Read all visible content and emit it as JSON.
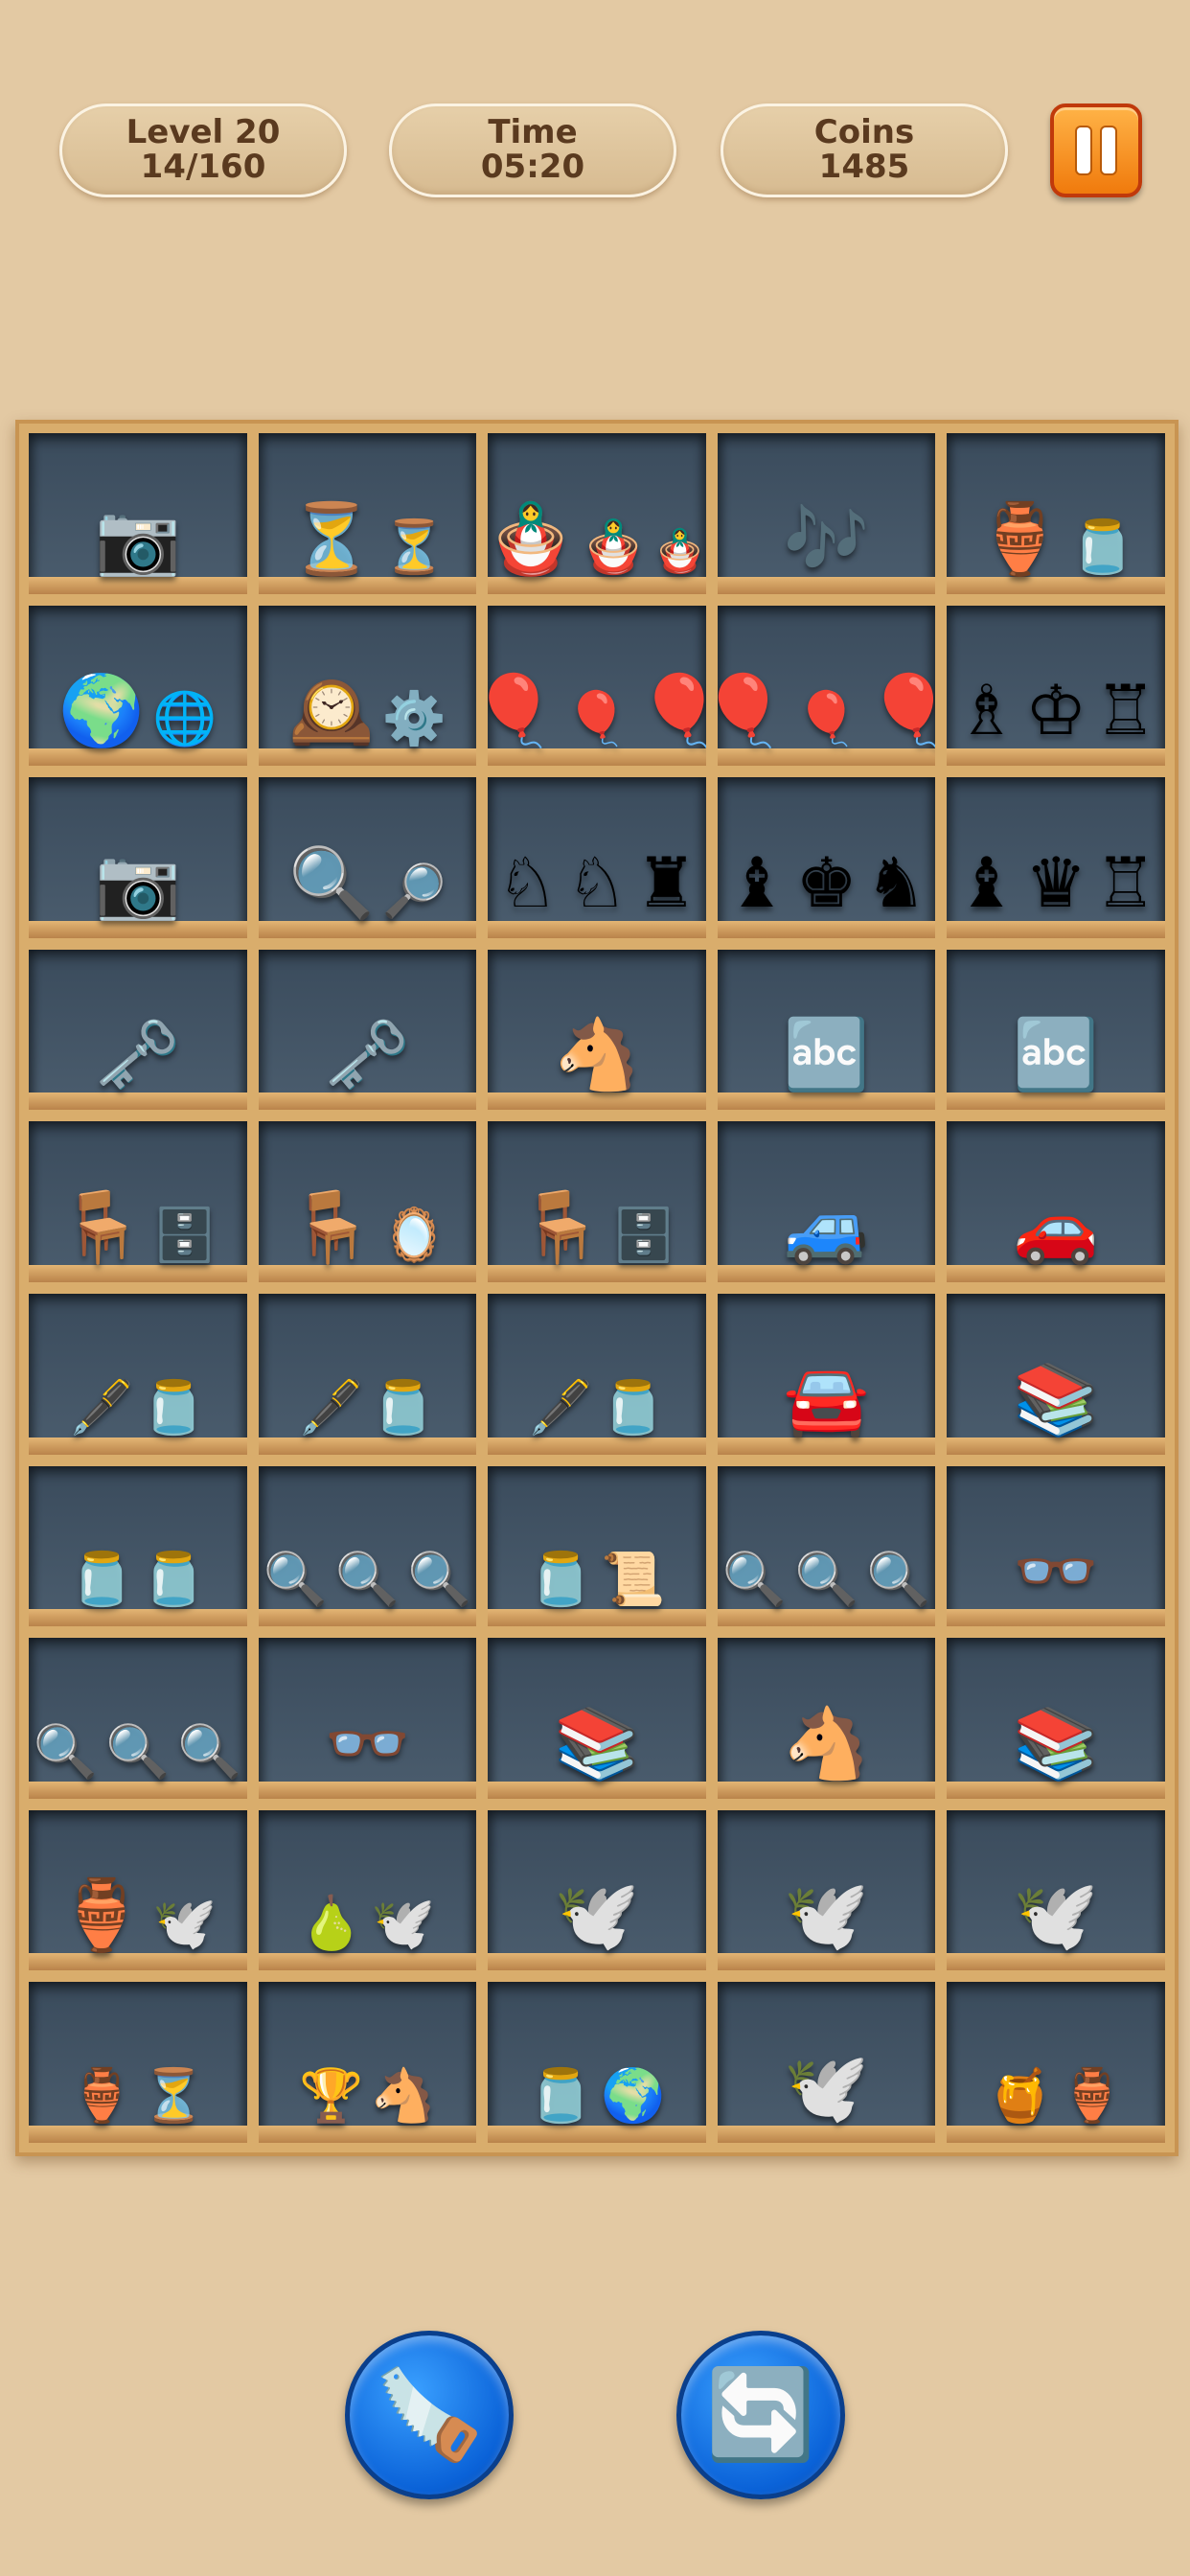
{
  "hud": {
    "level_label": "Level 20",
    "level_progress": "14/160",
    "time_label": "Time",
    "time_value": "05:20",
    "coins_label": "Coins",
    "coins_value": "1485"
  },
  "shelf": {
    "rows": [
      [
        {
          "items": [
            {
              "icon": "📷",
              "name": "vintage-camera-icon"
            }
          ]
        },
        {
          "items": [
            {
              "icon": "⏳",
              "name": "hourglass-icon"
            },
            {
              "icon": "⏳",
              "name": "hourglass-small-icon",
              "size": "sm"
            }
          ]
        },
        {
          "items": [
            {
              "icon": "🪆",
              "name": "nesting-doll-icon"
            },
            {
              "icon": "🪆",
              "name": "nesting-doll-medium-icon",
              "size": "sm"
            },
            {
              "icon": "🪆",
              "name": "nesting-doll-small-icon",
              "size": "xs"
            }
          ]
        },
        {
          "items": [
            {
              "icon": "🎶",
              "name": "music-box-icon"
            }
          ]
        },
        {
          "items": [
            {
              "icon": "🏺",
              "name": "painted-jar-icon"
            },
            {
              "icon": "🫙",
              "name": "porcelain-jar-icon",
              "size": "sm"
            }
          ]
        }
      ],
      [
        {
          "items": [
            {
              "icon": "🌍",
              "name": "globe-icon"
            },
            {
              "icon": "🌐",
              "name": "globe-small-icon",
              "size": "sm"
            }
          ]
        },
        {
          "items": [
            {
              "icon": "🕰️",
              "name": "pocket-watch-icon"
            },
            {
              "icon": "⚙️",
              "name": "pocket-watch-gears-icon",
              "size": "sm"
            }
          ]
        },
        {
          "items": [
            {
              "icon": "🎈",
              "name": "hot-air-balloon-icon"
            },
            {
              "icon": "🎈",
              "name": "hot-air-balloon-small-icon",
              "size": "sm"
            },
            {
              "icon": "🎈",
              "name": "hot-air-balloon-blue-icon"
            }
          ]
        },
        {
          "items": [
            {
              "icon": "🎈",
              "name": "hot-air-balloon-icon"
            },
            {
              "icon": "🎈",
              "name": "hot-air-balloon-small-icon",
              "size": "sm"
            },
            {
              "icon": "🎈",
              "name": "hot-air-balloon-blue-icon"
            }
          ]
        },
        {
          "items": [
            {
              "icon": "♗",
              "name": "chess-bishop-white-icon"
            },
            {
              "icon": "♔",
              "name": "chess-king-white-icon"
            },
            {
              "icon": "♖",
              "name": "chess-rook-white-icon"
            }
          ]
        }
      ],
      [
        {
          "items": [
            {
              "icon": "📷",
              "name": "brass-camera-icon"
            }
          ]
        },
        {
          "items": [
            {
              "icon": "🔍",
              "name": "magnifier-stand-icon"
            },
            {
              "icon": "🔎",
              "name": "magnifier-small-icon",
              "size": "sm"
            }
          ]
        },
        {
          "items": [
            {
              "icon": "♘",
              "name": "chess-knight-white-icon"
            },
            {
              "icon": "♘",
              "name": "chess-knight-white-icon"
            },
            {
              "icon": "♜",
              "name": "chess-rook-dark-icon"
            }
          ]
        },
        {
          "items": [
            {
              "icon": "♝",
              "name": "chess-bishop-dark-icon"
            },
            {
              "icon": "♚",
              "name": "chess-king-dark-icon"
            },
            {
              "icon": "♞",
              "name": "chess-knight-dark-icon"
            }
          ]
        },
        {
          "items": [
            {
              "icon": "♝",
              "name": "chess-bishop-dark-icon"
            },
            {
              "icon": "♛",
              "name": "chess-queen-dark-icon"
            },
            {
              "icon": "♖",
              "name": "chess-rook-white-icon"
            }
          ]
        }
      ],
      [
        {
          "items": [
            {
              "icon": "🗝️",
              "name": "key-ring-icon"
            }
          ]
        },
        {
          "items": [
            {
              "icon": "🗝️",
              "name": "key-ring-icon"
            }
          ]
        },
        {
          "items": [
            {
              "icon": "🐴",
              "name": "rocking-horse-icon"
            }
          ]
        },
        {
          "items": [
            {
              "icon": "🔤",
              "name": "abc-blocks-icon"
            }
          ]
        },
        {
          "items": [
            {
              "icon": "🔤",
              "name": "abc-blocks-icon"
            }
          ]
        }
      ],
      [
        {
          "items": [
            {
              "icon": "🪑",
              "name": "armchair-icon"
            },
            {
              "icon": "🗄️",
              "name": "dresser-icon",
              "size": "sm"
            }
          ]
        },
        {
          "items": [
            {
              "icon": "🪑",
              "name": "red-chair-icon"
            },
            {
              "icon": "🪞",
              "name": "vanity-dresser-icon",
              "size": "sm"
            }
          ]
        },
        {
          "items": [
            {
              "icon": "🪑",
              "name": "wooden-chair-icon"
            },
            {
              "icon": "🗄️",
              "name": "chest-of-drawers-icon",
              "size": "sm"
            }
          ]
        },
        {
          "items": [
            {
              "icon": "🚙",
              "name": "yellow-vintage-car-icon"
            }
          ]
        },
        {
          "items": [
            {
              "icon": "🚗",
              "name": "red-vintage-car-icon"
            }
          ]
        }
      ],
      [
        {
          "items": [
            {
              "icon": "🖋️",
              "name": "ink-bottle-icon",
              "size": "sm"
            },
            {
              "icon": "🫙",
              "name": "ink-bottle-dark-icon",
              "size": "sm"
            }
          ]
        },
        {
          "items": [
            {
              "icon": "🖋️",
              "name": "ink-bottle-icon",
              "size": "sm"
            },
            {
              "icon": "🫙",
              "name": "ink-bottle-blue-icon",
              "size": "sm"
            }
          ]
        },
        {
          "items": [
            {
              "icon": "🖋️",
              "name": "ink-bottle-icon",
              "size": "sm"
            },
            {
              "icon": "🫙",
              "name": "ink-bottle-blue-icon",
              "size": "sm"
            }
          ]
        },
        {
          "items": [
            {
              "icon": "🚘",
              "name": "blue-vintage-car-icon"
            }
          ]
        },
        {
          "items": [
            {
              "icon": "📚",
              "name": "old-books-icon"
            }
          ]
        }
      ],
      [
        {
          "items": [
            {
              "icon": "🫙",
              "name": "ink-bottle-red-icon",
              "size": "sm"
            },
            {
              "icon": "🫙",
              "name": "ink-bottle-brown-icon",
              "size": "sm"
            }
          ]
        },
        {
          "items": [
            {
              "icon": "🔍",
              "name": "magnifier-icon",
              "size": "sm"
            },
            {
              "icon": "🔍",
              "name": "magnifier-icon",
              "size": "sm"
            },
            {
              "icon": "🔍",
              "name": "magnifier-icon",
              "size": "sm"
            }
          ]
        },
        {
          "items": [
            {
              "icon": "🫙",
              "name": "ink-bottle-green-icon",
              "size": "sm"
            },
            {
              "icon": "📜",
              "name": "scroll-icon",
              "size": "sm"
            }
          ]
        },
        {
          "items": [
            {
              "icon": "🔍",
              "name": "magnifier-icon",
              "size": "sm"
            },
            {
              "icon": "🔍",
              "name": "magnifier-icon",
              "size": "sm"
            },
            {
              "icon": "🔍",
              "name": "magnifier-icon",
              "size": "sm"
            }
          ]
        },
        {
          "items": [
            {
              "icon": "👓",
              "name": "spectacles-icon"
            }
          ]
        }
      ],
      [
        {
          "items": [
            {
              "icon": "🔍",
              "name": "magnifier-icon",
              "size": "sm"
            },
            {
              "icon": "🔍",
              "name": "magnifier-icon",
              "size": "sm"
            },
            {
              "icon": "🔍",
              "name": "magnifier-icon",
              "size": "sm"
            }
          ]
        },
        {
          "items": [
            {
              "icon": "👓",
              "name": "spectacles-icon"
            }
          ]
        },
        {
          "items": [
            {
              "icon": "📚",
              "name": "old-books-icon"
            }
          ]
        },
        {
          "items": [
            {
              "icon": "🐴",
              "name": "rocking-horse-icon"
            }
          ]
        },
        {
          "items": [
            {
              "icon": "📚",
              "name": "old-books-icon"
            }
          ]
        }
      ],
      [
        {
          "items": [
            {
              "icon": "🏺",
              "name": "clay-vase-icon"
            },
            {
              "icon": "🕊️",
              "name": "bird-whistle-icon",
              "size": "sm"
            }
          ]
        },
        {
          "items": [
            {
              "icon": "🍐",
              "name": "green-vase-icon",
              "size": "sm"
            },
            {
              "icon": "🕊️",
              "name": "bird-whistle-icon",
              "size": "sm"
            }
          ]
        },
        {
          "items": [
            {
              "icon": "🕊️",
              "name": "painted-bird-whistle-icon"
            }
          ]
        },
        {
          "items": [
            {
              "icon": "🕊️",
              "name": "blue-flower-whistle-icon"
            }
          ]
        },
        {
          "items": [
            {
              "icon": "🕊️",
              "name": "red-flower-whistle-icon"
            }
          ]
        }
      ],
      [
        {
          "items": [
            {
              "icon": "🏺",
              "name": "blue-white-vase-icon",
              "size": "sm"
            },
            {
              "icon": "⏳",
              "name": "hourglass-icon",
              "size": "sm"
            }
          ]
        },
        {
          "items": [
            {
              "icon": "🏆",
              "name": "angel-figurine-icon",
              "size": "sm"
            },
            {
              "icon": "🐴",
              "name": "rocking-horse-small-icon",
              "size": "sm"
            }
          ]
        },
        {
          "items": [
            {
              "icon": "🫙",
              "name": "blue-white-jar-icon",
              "size": "sm"
            },
            {
              "icon": "🌍",
              "name": "globe-icon",
              "size": "sm"
            }
          ]
        },
        {
          "items": [
            {
              "icon": "🕊️",
              "name": "teal-bird-whistle-icon"
            }
          ]
        },
        {
          "items": [
            {
              "icon": "🍯",
              "name": "painted-pot-icon",
              "size": "sm"
            },
            {
              "icon": "🏺",
              "name": "bud-vase-icon",
              "size": "sm"
            }
          ]
        }
      ]
    ]
  },
  "tools": {
    "chainsaw_icon": "🪚",
    "shuffle_icon": "🔄"
  },
  "colors": {
    "background": "#e3c9a3",
    "cell": "#3a4b5c",
    "shelf_wood": "#d9ad6c",
    "pause": "#f07a0c",
    "tool_button": "#0a62d8"
  }
}
